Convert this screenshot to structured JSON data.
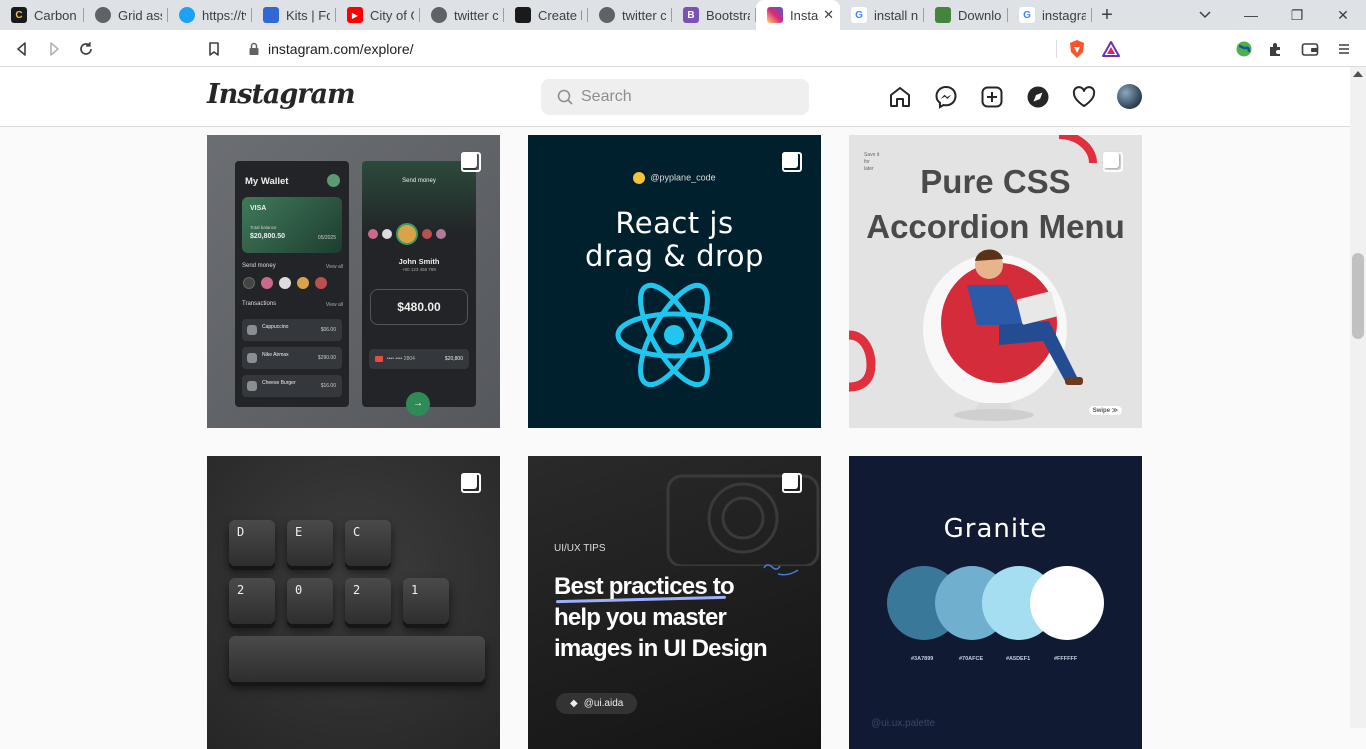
{
  "browser": {
    "tabs": [
      {
        "label": "Carbon |",
        "icon": "carbon-icon",
        "color": "#1a1a1a"
      },
      {
        "label": "Grid assis",
        "icon": "globe-icon",
        "color": "#5f6368"
      },
      {
        "label": "https://tv",
        "icon": "twitter-icon",
        "color": "#1da1f2"
      },
      {
        "label": "Kits | For",
        "icon": "flag-icon",
        "color": "#3367d6"
      },
      {
        "label": "City of G",
        "icon": "youtube-icon",
        "color": "#ff0000"
      },
      {
        "label": "twitter cl",
        "icon": "globe-icon",
        "color": "#5f6368"
      },
      {
        "label": "Create b",
        "icon": "create-icon",
        "color": "#1a1a1a"
      },
      {
        "label": "twitter cl",
        "icon": "globe-icon",
        "color": "#5f6368"
      },
      {
        "label": "Bootstra",
        "icon": "bootstrap-icon",
        "color": "#7952b3"
      },
      {
        "label": "Insta",
        "icon": "instagram-icon",
        "color": "#d6249f",
        "active": true
      },
      {
        "label": "install np",
        "icon": "google-icon",
        "color": "#4285f4"
      },
      {
        "label": "Downloa",
        "icon": "node-icon",
        "color": "#43853d"
      },
      {
        "label": "instagran",
        "icon": "google-icon",
        "color": "#4285f4"
      }
    ],
    "url": "instagram.com/explore/"
  },
  "instagram": {
    "logo": "Instagram",
    "search_placeholder": "Search"
  },
  "posts": {
    "wallet": {
      "title": "My Wallet",
      "card_brand": "VISA",
      "total_balance_label": "Total balance",
      "balance": "$20,800.50",
      "expiry": "05/2025",
      "send_money": "Send money",
      "view_all": "View all",
      "transactions": "Transactions",
      "view_all_2": "View all",
      "tx": [
        {
          "name": "Cappuccino",
          "amount": "$06.00"
        },
        {
          "name": "Nike Airmax",
          "amount": "$290.00"
        },
        {
          "name": "Cheese Burger",
          "amount": "$16.00"
        }
      ],
      "send_title": "Send money",
      "recipient": "John Smith",
      "phone": "+00 123 456 789",
      "amount": "$480.00",
      "card_masked": "•••• •••• 2804",
      "card_amount": "$20,800",
      "go_arrow": "→"
    },
    "react": {
      "handle": "@pyplane_code",
      "line1": "React js",
      "line2": "drag & drop"
    },
    "accordion": {
      "line1": "Pure CSS",
      "line2": "Accordion Menu",
      "swipe": "Swipe ≫",
      "corner1": "Save it",
      "corner2": "for",
      "corner3": "later"
    },
    "keyboard": {
      "keys": [
        "D",
        "E",
        "C",
        "2",
        "0",
        "2",
        "1"
      ]
    },
    "tips": {
      "label": "UI/UX TIPS",
      "line1": "Best practices to",
      "line2": "help you master",
      "line3": "images in UI Design",
      "handle": "@ui.aida"
    },
    "granite": {
      "title": "Granite",
      "swatches": [
        {
          "hex": "#3A7899"
        },
        {
          "hex": "#70AFCE"
        },
        {
          "hex": "#A5DEF1"
        },
        {
          "hex": "#FFFFFF"
        }
      ],
      "footer": "@ui.ux.palette"
    }
  }
}
